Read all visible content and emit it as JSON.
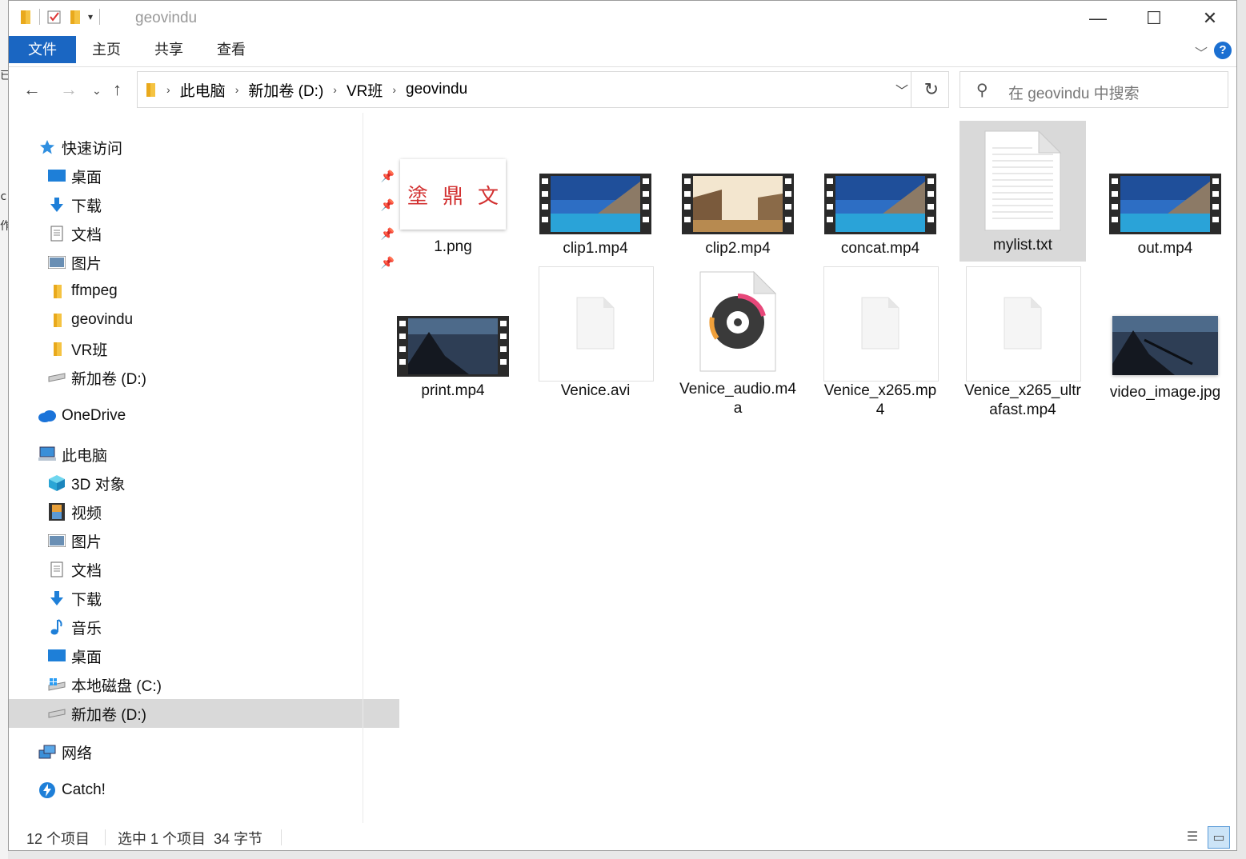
{
  "window": {
    "title": "geovindu",
    "minimize": "—",
    "maximize": "☐",
    "close": "✕"
  },
  "ribbon": {
    "tabs": [
      "文件",
      "主页",
      "共享",
      "查看"
    ],
    "help": "?"
  },
  "address": {
    "crumbs": [
      "此电脑",
      "新加卷 (D:)",
      "VR班",
      "geovindu"
    ]
  },
  "search": {
    "placeholder": "在 geovindu 中搜索"
  },
  "nav": {
    "quick_access": "快速访问",
    "quick_items": [
      "桌面",
      "下载",
      "文档",
      "图片",
      "ffmpeg",
      "geovindu",
      "VR班",
      "新加卷 (D:)"
    ],
    "onedrive": "OneDrive",
    "this_pc": "此电脑",
    "pc_items": [
      "3D 对象",
      "视频",
      "图片",
      "文档",
      "下载",
      "音乐",
      "桌面",
      "本地磁盘 (C:)",
      "新加卷 (D:)"
    ],
    "network": "网络",
    "catch": "Catch!"
  },
  "files": [
    {
      "name": "1.png",
      "kind": "png"
    },
    {
      "name": "clip1.mp4",
      "kind": "video"
    },
    {
      "name": "clip2.mp4",
      "kind": "video-sunset"
    },
    {
      "name": "concat.mp4",
      "kind": "video"
    },
    {
      "name": "mylist.txt",
      "kind": "txt",
      "selected": true
    },
    {
      "name": "out.mp4",
      "kind": "video"
    },
    {
      "name": "print.mp4",
      "kind": "video-dark"
    },
    {
      "name": "Venice.avi",
      "kind": "blank"
    },
    {
      "name": "Venice_audio.m4a",
      "kind": "audio"
    },
    {
      "name": "Venice_x265.mp4",
      "kind": "blank"
    },
    {
      "name": "Venice_x265_ultrafast.mp4",
      "kind": "blank"
    },
    {
      "name": "video_image.jpg",
      "kind": "jpg-dark"
    }
  ],
  "png_chars": [
    "塗",
    "鼎",
    "文"
  ],
  "status": {
    "count": "12 个项目",
    "selection": "选中 1 个项目  34 字节"
  },
  "colors": {
    "accent": "#1a66c2",
    "selected": "#d9d9d9"
  }
}
